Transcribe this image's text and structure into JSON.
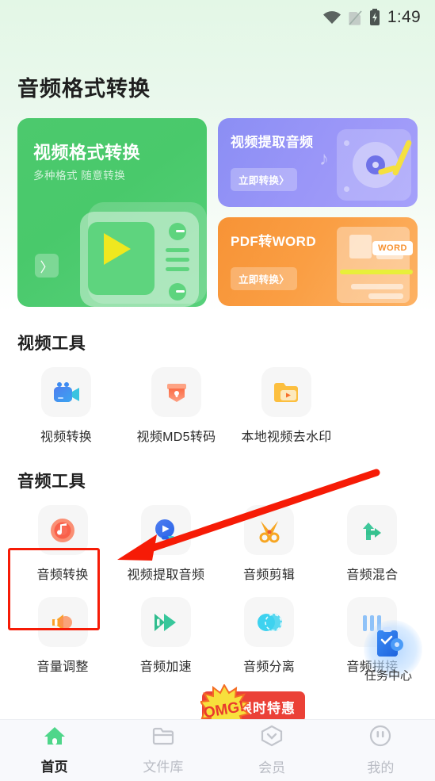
{
  "status_bar": {
    "time": "1:49",
    "wifi_icon": "wifi-icon",
    "sim_icon": "sim-card-off-icon",
    "battery_icon": "battery-charging-icon"
  },
  "header": {
    "title": "音频格式转换"
  },
  "banners": {
    "primary": {
      "title": "视频格式转换",
      "subtitle": "多种格式 随意转换",
      "next_arrow": "〉",
      "color": "#4cc96d"
    },
    "secondary": [
      {
        "title": "视频提取音频",
        "cta": "立即转换〉",
        "color": "#8b8ef4"
      },
      {
        "title": "PDF转WORD",
        "cta": "立即转换〉",
        "badge": "WORD",
        "color": "#f79336"
      }
    ]
  },
  "sections": [
    {
      "title": "视频工具",
      "tools": [
        {
          "label": "视频转换",
          "icon": "video-camera-icon",
          "color": "#3d8bf2"
        },
        {
          "label": "视频MD5转码",
          "icon": "shield-lock-icon",
          "color": "#fb7e5c"
        },
        {
          "label": "本地视频去水印",
          "icon": "folder-play-icon",
          "color": "#fcb730"
        }
      ]
    },
    {
      "title": "音频工具",
      "tools_row1": [
        {
          "label": "音频转换",
          "icon": "vinyl-record-icon",
          "color": "#f9795f",
          "selected": true
        },
        {
          "label": "视频提取音频",
          "icon": "play-circle-icon",
          "color": "#3d74f2"
        },
        {
          "label": "音频剪辑",
          "icon": "scissors-icon",
          "color": "#f5a623"
        },
        {
          "label": "音频混合",
          "icon": "merge-arrows-icon",
          "color": "#3ec79a"
        }
      ],
      "tools_row2": [
        {
          "label": "音量调整",
          "icon": "speaker-volume-icon",
          "color": "#fba128"
        },
        {
          "label": "音频加速",
          "icon": "fast-forward-icon",
          "color": "#2fbd8e"
        },
        {
          "label": "音频分离",
          "icon": "overlapping-circles-icon",
          "color": "#3ed2ef"
        },
        {
          "label": "音频拼接",
          "icon": "audio-join-icon",
          "color": "#3d8bf2"
        }
      ]
    }
  ],
  "promo": {
    "burst_text": "OMG!",
    "label": "限时特惠",
    "color": "#eb4137"
  },
  "task_center": {
    "label": "任务中心",
    "icon": "clipboard-check-icon"
  },
  "bottom_nav": [
    {
      "label": "首页",
      "icon": "home-icon",
      "active": true
    },
    {
      "label": "文件库",
      "icon": "folder-icon",
      "active": false
    },
    {
      "label": "会员",
      "icon": "membership-hexagon-icon",
      "active": false
    },
    {
      "label": "我的",
      "icon": "profile-face-icon",
      "active": false
    }
  ]
}
